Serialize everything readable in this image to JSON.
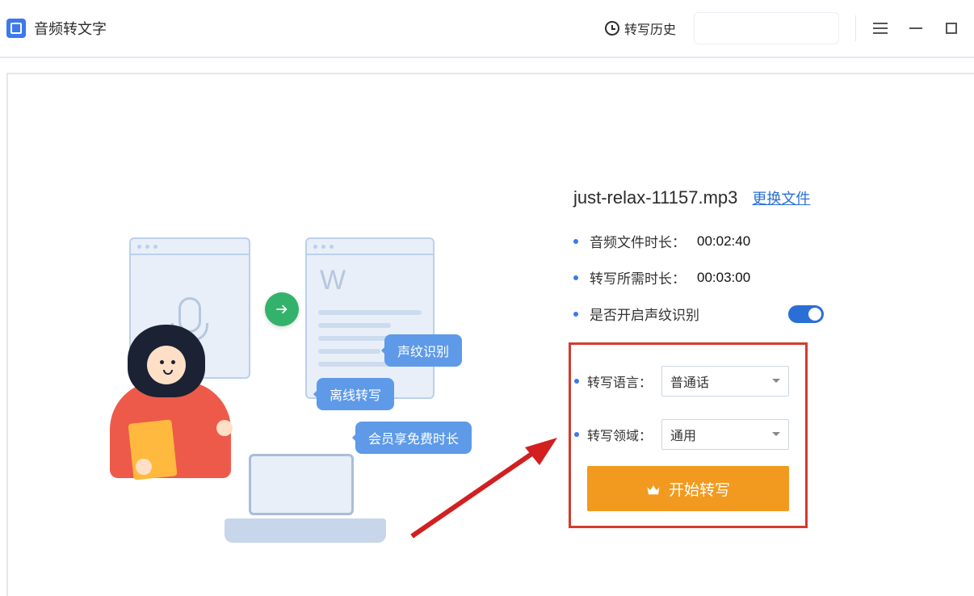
{
  "titlebar": {
    "app_title": "音频转文字",
    "history_label": "转写历史"
  },
  "illustration": {
    "bubble1": "声纹识别",
    "bubble2": "离线转写",
    "bubble3": "会员享免费时长"
  },
  "file": {
    "name": "just-relax-11157.mp3",
    "change_link": "更换文件"
  },
  "info": {
    "duration_label": "音频文件时长：",
    "duration_value": "00:02:40",
    "needed_label": "转写所需时长：",
    "needed_value": "00:03:00",
    "voiceprint_label": "是否开启声纹识别",
    "voiceprint_on": true
  },
  "options": {
    "lang_label": "转写语言：",
    "lang_value": "普通话",
    "domain_label": "转写领域：",
    "domain_value": "通用"
  },
  "action": {
    "start_label": "开始转写"
  }
}
